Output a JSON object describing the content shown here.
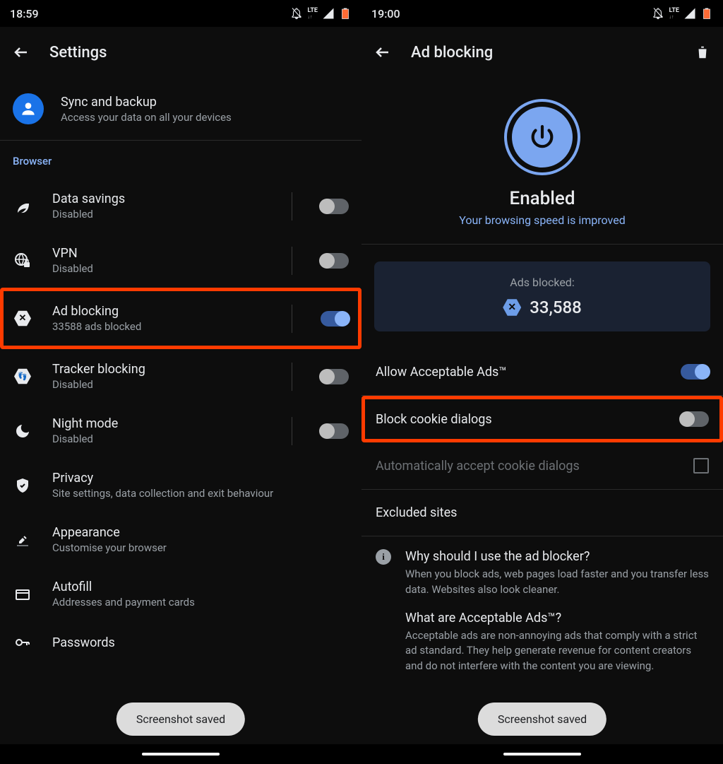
{
  "left": {
    "status_time": "18:59",
    "title": "Settings",
    "sync": {
      "title": "Sync and backup",
      "sub": "Access your data on all your devices"
    },
    "section_label": "Browser",
    "rows": {
      "data_savings": {
        "title": "Data savings",
        "sub": "Disabled"
      },
      "vpn": {
        "title": "VPN",
        "sub": "Disabled"
      },
      "ad_blocking": {
        "title": "Ad blocking",
        "sub": "33588 ads blocked"
      },
      "tracker": {
        "title": "Tracker blocking",
        "sub": "Disabled"
      },
      "night": {
        "title": "Night mode",
        "sub": "Disabled"
      },
      "privacy": {
        "title": "Privacy",
        "sub": "Site settings, data collection and exit behaviour"
      },
      "appearance": {
        "title": "Appearance",
        "sub": "Customise your browser"
      },
      "autofill": {
        "title": "Autofill",
        "sub": "Addresses and payment cards"
      },
      "passwords": {
        "title": "Passwords"
      }
    },
    "toast": "Screenshot saved"
  },
  "right": {
    "status_time": "19:00",
    "title": "Ad blocking",
    "hero_status": "Enabled",
    "hero_sub": "Your browsing speed is improved",
    "stats_label": "Ads blocked:",
    "stats_value": "33,588",
    "allow_acceptable": "Allow Acceptable Ads™",
    "block_cookie": "Block cookie dialogs",
    "auto_accept": "Automatically accept cookie dialogs",
    "excluded": "Excluded sites",
    "info1_q": "Why should I use the ad blocker?",
    "info1_a": "When you block ads, web pages load faster and you transfer less data. Websites also look cleaner.",
    "info2_q": "What are Acceptable Ads™?",
    "info2_a": "Acceptable ads are non-annoying ads that comply with a strict ad standard. They help generate revenue for content creators and do not interfere with the content you are viewing.",
    "toast": "Screenshot saved"
  }
}
